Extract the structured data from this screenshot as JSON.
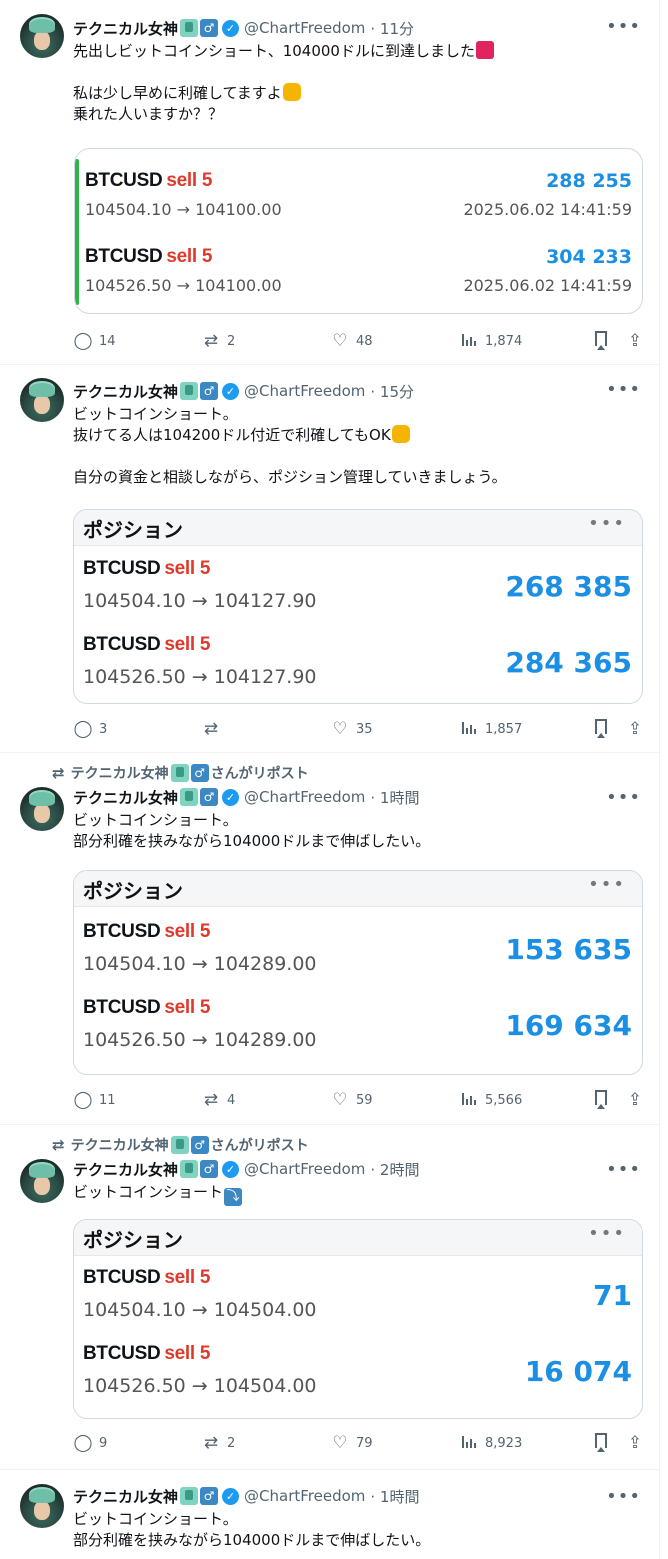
{
  "tweets": [
    {
      "author": "テクニカル女神",
      "gender": "♂",
      "handle": "@ChartFreedom",
      "time": "· 11分",
      "repost_by": "",
      "text_line1": "先出しビットコインショート、104000ドルに到達しました",
      "text_line2": "",
      "text_line3": "私は少し早めに利確してますよ",
      "text_line4": "乗れた人いますか？？",
      "card": {
        "rows": [
          {
            "symbol": "BTCUSD",
            "side": "sell 5",
            "route": "104504.10 → 104100.00",
            "value": "288 255",
            "date": "2025.06.02 14:41:59"
          },
          {
            "symbol": "BTCUSD",
            "side": "sell 5",
            "route": "104526.50 → 104100.00",
            "value": "304 233",
            "date": "2025.06.02 14:41:59"
          }
        ]
      },
      "stats": {
        "replies": "14",
        "reposts": "2",
        "likes": "48",
        "views": "1,874"
      }
    },
    {
      "author": "テクニカル女神",
      "gender": "♂",
      "handle": "@ChartFreedom",
      "time": "· 15分",
      "text_line1": "ビットコインショート。",
      "text_line2": "抜けてる人は104200ドル付近で利確してもOK",
      "text_line3": "自分の資金と相談しながら、ポジション管理していきましょう。",
      "card": {
        "title": "ポジション",
        "rows": [
          {
            "symbol": "BTCUSD",
            "side": "sell 5",
            "route": "104504.10 → 104127.90",
            "pnl": "268 385"
          },
          {
            "symbol": "BTCUSD",
            "side": "sell 5",
            "route": "104526.50 → 104127.90",
            "pnl": "284 365"
          }
        ]
      },
      "stats": {
        "replies": "3",
        "reposts": "",
        "likes": "35",
        "views": "1,857"
      }
    },
    {
      "author": "テクニカル女神",
      "gender": "♂",
      "handle": "@ChartFreedom",
      "time": "· 1時間",
      "repost_label": "テクニカル女神",
      "repost_suffix": "さんがリポスト",
      "text_line1": "ビットコインショート。",
      "text_line2": "部分利確を挟みながら104000ドルまで伸ばしたい。",
      "card": {
        "title": "ポジション",
        "rows": [
          {
            "symbol": "BTCUSD",
            "side": "sell 5",
            "route": "104504.10 → 104289.00",
            "pnl": "153 635"
          },
          {
            "symbol": "BTCUSD",
            "side": "sell 5",
            "route": "104526.50 → 104289.00",
            "pnl": "169 634"
          }
        ]
      },
      "stats": {
        "replies": "11",
        "reposts": "4",
        "likes": "59",
        "views": "5,566"
      }
    },
    {
      "author": "テクニカル女神",
      "gender": "♂",
      "handle": "@ChartFreedom",
      "time": "· 2時間",
      "repost_label": "テクニカル女神",
      "repost_suffix": "さんがリポスト",
      "text_line1": "ビットコインショート",
      "card": {
        "title": "ポジション",
        "rows": [
          {
            "symbol": "BTCUSD",
            "side": "sell 5",
            "route": "104504.10 → 104504.00",
            "pnl": "71"
          },
          {
            "symbol": "BTCUSD",
            "side": "sell 5",
            "route": "104526.50 → 104504.00",
            "pnl": "16 074"
          }
        ]
      },
      "stats": {
        "replies": "9",
        "reposts": "2",
        "likes": "79",
        "views": "8,923"
      }
    },
    {
      "author": "テクニカル女神",
      "gender": "♂",
      "handle": "@ChartFreedom",
      "time": "· 1時間",
      "text_line1": "ビットコインショート。",
      "text_line2": "部分利確を挟みながら104000ドルまで伸ばしたい。"
    }
  ],
  "icons": {
    "reply": "reply-icon",
    "repost": "repost-icon",
    "like": "heart-icon",
    "views": "views-icon",
    "bookmark": "bookmark-icon",
    "share": "share-icon",
    "more": "more-icon",
    "verified": "verified-badge-icon"
  },
  "colors": {
    "accent_blue": "#1a8fe3",
    "sell_red": "#e0392b",
    "card_accent_green": "#2fb344",
    "verified_blue": "#1d9bf0"
  }
}
